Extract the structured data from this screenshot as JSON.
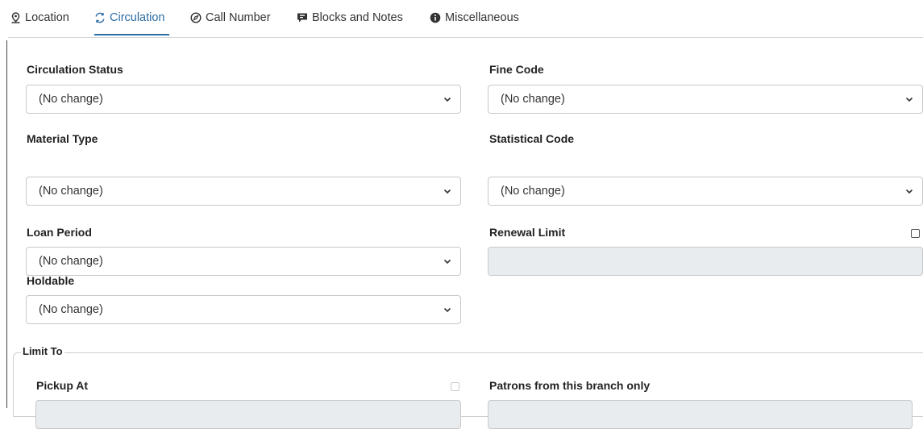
{
  "tabs": [
    {
      "label": "Location",
      "icon": "map-marker-icon",
      "active": false
    },
    {
      "label": "Circulation",
      "icon": "circulation-icon",
      "active": true
    },
    {
      "label": "Call Number",
      "icon": "compass-icon",
      "active": false
    },
    {
      "label": "Blocks and Notes",
      "icon": "comment-icon",
      "active": false
    },
    {
      "label": "Miscellaneous",
      "icon": "info-icon",
      "active": false
    }
  ],
  "fields": {
    "circulation_status": {
      "label": "Circulation Status",
      "value": "(No change)"
    },
    "fine_code": {
      "label": "Fine Code",
      "value": "(No change)"
    },
    "material_type": {
      "label": "Material Type",
      "value": "(No change)"
    },
    "statistical_code": {
      "label": "Statistical Code",
      "value": "(No change)"
    },
    "loan_period": {
      "label": "Loan Period",
      "value": "(No change)"
    },
    "renewal_limit": {
      "label": "Renewal Limit",
      "value": ""
    },
    "holdable": {
      "label": "Holdable",
      "value": "(No change)"
    }
  },
  "limit_to": {
    "legend": "Limit To",
    "pickup_at": {
      "label": "Pickup At"
    },
    "patrons_branch": {
      "label": "Patrons from this branch only"
    }
  },
  "colors": {
    "accent": "#2b6ca3",
    "border": "#c8c8c8",
    "disabled_bg": "#e9ecef"
  }
}
